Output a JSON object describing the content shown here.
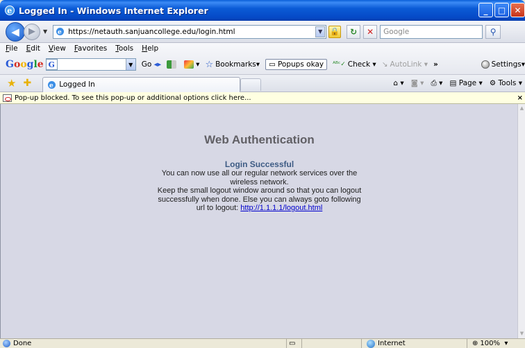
{
  "window": {
    "title": "Logged In - Windows Internet Explorer",
    "buttons": [
      "_",
      "□",
      "X"
    ]
  },
  "address_bar": {
    "url": "https://netauth.sanjuancollege.edu/login.html",
    "search_placeholder": "Google"
  },
  "menu": {
    "items": [
      "File",
      "Edit",
      "View",
      "Favorites",
      "Tools",
      "Help"
    ]
  },
  "google_toolbar": {
    "logo": "Google",
    "search_icon": "G",
    "go_label": "Go",
    "bookmarks_label": "Bookmarks",
    "popups_label": "Popups okay",
    "check_label": "Check",
    "autolink_label": "AutoLink",
    "more_label": "»",
    "settings_label": "Settings"
  },
  "tabs": {
    "active_tab_label": "Logged In",
    "commands": {
      "page_label": "Page",
      "tools_label": "Tools"
    }
  },
  "info_bar": {
    "text": "Pop-up blocked. To see this pop-up or additional options click here..."
  },
  "page": {
    "heading": "Web Authentication",
    "success": "Login Successful",
    "line1": "You can now use all our regular network services over the",
    "line2": "wireless network.",
    "line3": "Keep the small logout window around so that you can logout",
    "line4": "successfully when done. Else you can always goto following",
    "line5_prefix": "url to logout: ",
    "logout_link": "http://1.1.1.1/logout.html"
  },
  "status_bar": {
    "status": "Done",
    "zone": "Internet",
    "zoom": "100%"
  },
  "colors": {
    "titlebar": "#0a55d2",
    "content_bg": "#d7d8e5",
    "heading": "#616065",
    "success": "#3d5b84",
    "link": "#0000cc"
  }
}
